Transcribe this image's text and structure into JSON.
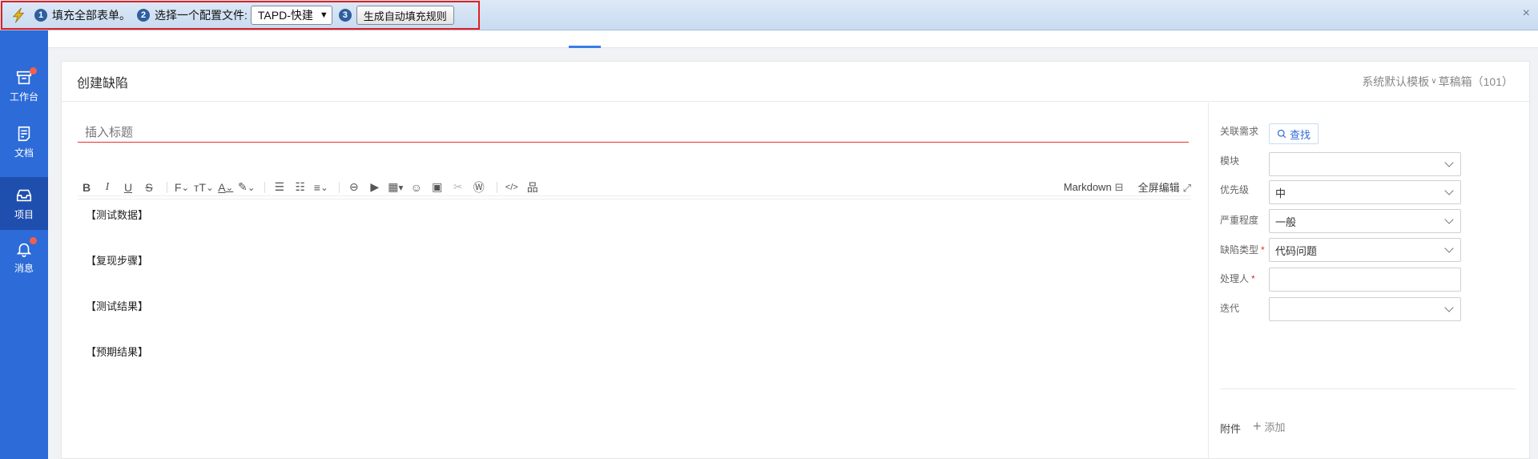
{
  "ext_bar": {
    "step1_num": "1",
    "step1_text": "填充全部表单。",
    "step2_num": "2",
    "step2_text": "选择一个配置文件:",
    "profile_selected": "TAPD-快建",
    "step3_num": "3",
    "generate_button": "生成自动填充规则",
    "close": "×"
  },
  "nav": {
    "items": [
      {
        "label": "工作台",
        "icon": "workbench-icon",
        "badge": true
      },
      {
        "label": "文档",
        "icon": "document-icon",
        "badge": false
      },
      {
        "label": "项目",
        "icon": "project-icon",
        "badge": false,
        "active": true
      },
      {
        "label": "消息",
        "icon": "bell-icon",
        "badge": true
      }
    ]
  },
  "page": {
    "title": "创建缺陷",
    "template_label": "系统默认模板",
    "drafts_label": "草稿箱（101）"
  },
  "editor": {
    "title_placeholder": "插入标题",
    "markdown_label": "Markdown",
    "fullscreen_label": "全屏编辑",
    "content": [
      "【测试数据】",
      "【复现步骤】",
      "【测试结果】",
      "【预期结果】"
    ]
  },
  "fields": {
    "related_req_label": "关联需求",
    "find_button": "查找",
    "module_label": "模块",
    "module_value": "",
    "priority_label": "优先级",
    "priority_value": "中",
    "severity_label": "严重程度",
    "severity_value": "一般",
    "bug_type_label": "缺陷类型",
    "bug_type_value": "代码问题",
    "assignee_label": "处理人",
    "assignee_value": "",
    "iteration_label": "迭代",
    "iteration_value": "",
    "required_mark": "*",
    "attach_label": "附件",
    "attach_add": "添加"
  },
  "colors": {
    "nav_bg": "#2d6bd8",
    "nav_active": "#1f4fae",
    "required_red": "#e62f2f",
    "highlight_red": "#e0201f"
  }
}
